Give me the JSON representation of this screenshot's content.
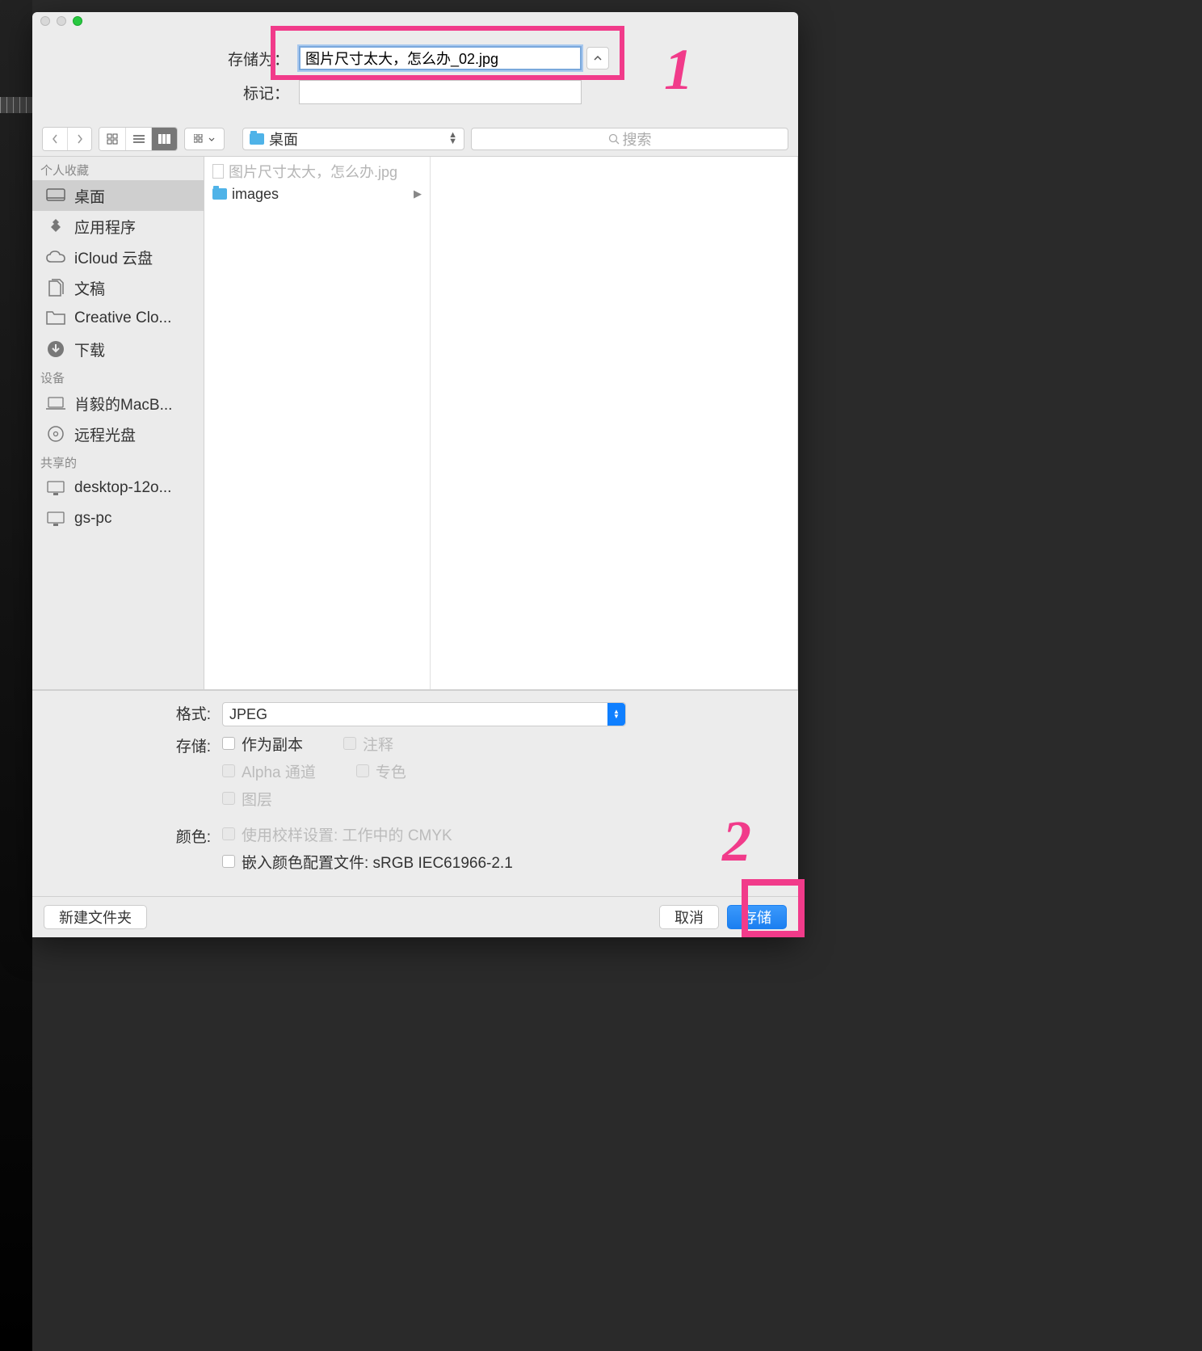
{
  "header": {
    "save_as_label": "存储为：",
    "filename_value": "图片尺寸太大，怎么办_02.jpg",
    "tags_label": "标记："
  },
  "toolbar": {
    "location": "桌面",
    "search_placeholder": "搜索"
  },
  "sidebar": {
    "favs_head": "个人收藏",
    "favs": [
      "桌面",
      "应用程序",
      "iCloud 云盘",
      "文稿",
      "Creative Clo...",
      "下载"
    ],
    "devices_head": "设备",
    "devices": [
      "肖毅的MacB...",
      "远程光盘"
    ],
    "shared_head": "共享的",
    "shared": [
      "desktop-12o...",
      "gs-pc"
    ]
  },
  "column": {
    "file1": "图片尺寸太大，怎么办.jpg",
    "folder1": "images"
  },
  "options": {
    "format_label": "格式:",
    "format_value": "JPEG",
    "save_label": "存储:",
    "chk_copy": "作为副本",
    "chk_notes": "注释",
    "chk_alpha": "Alpha 通道",
    "chk_spot": "专色",
    "chk_layers": "图层",
    "color_label": "颜色:",
    "chk_proof": "使用校样设置: 工作中的 CMYK",
    "chk_embed": "嵌入颜色配置文件: sRGB IEC61966-2.1"
  },
  "footer": {
    "new_folder": "新建文件夹",
    "cancel": "取消",
    "save": "存储"
  },
  "annotations": {
    "one": "1",
    "two": "2"
  }
}
